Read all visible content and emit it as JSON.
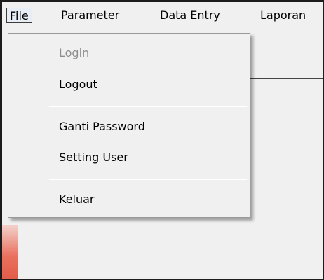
{
  "menubar": {
    "items": [
      {
        "label": "File"
      },
      {
        "label": "Parameter"
      },
      {
        "label": "Data Entry"
      },
      {
        "label": "Laporan"
      }
    ]
  },
  "file_menu": {
    "login": "Login",
    "logout": "Logout",
    "ganti_password": "Ganti Password",
    "setting_user": "Setting User",
    "keluar": "Keluar"
  }
}
